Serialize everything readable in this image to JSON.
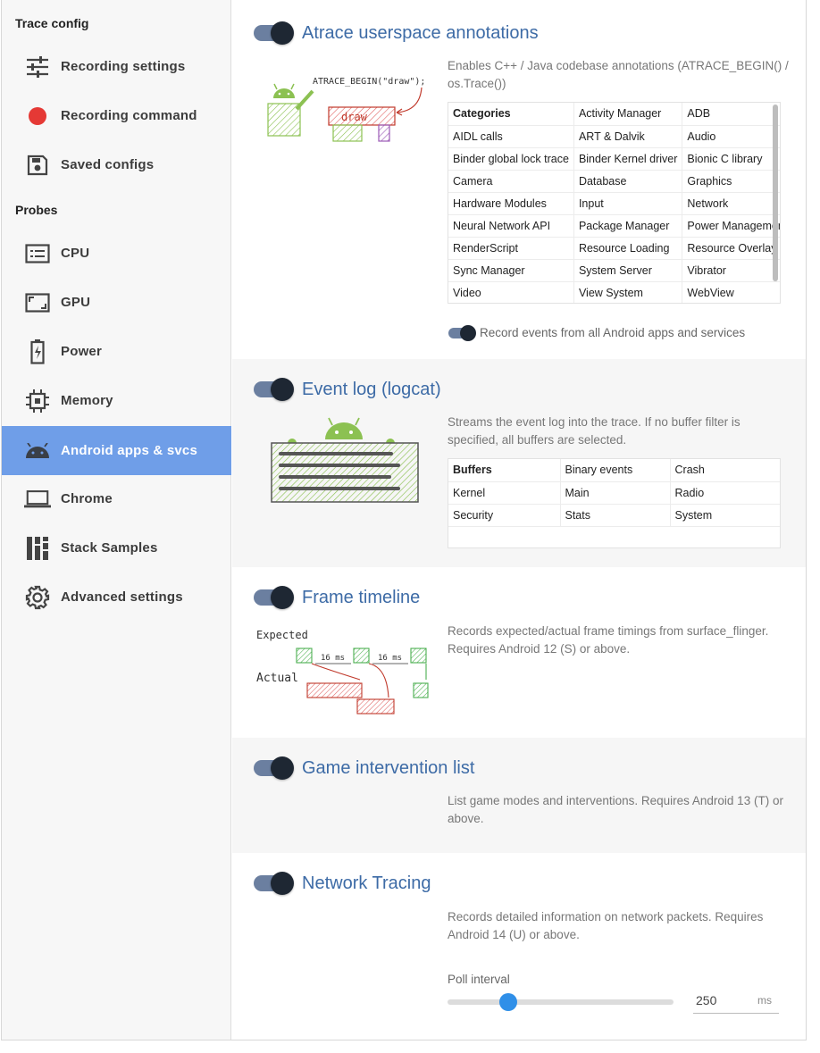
{
  "sidebar": {
    "section_trace_config": "Trace config",
    "section_probes": "Probes",
    "items": [
      {
        "label": "Recording settings",
        "icon": "tune-icon"
      },
      {
        "label": "Recording command",
        "icon": "record-dot-icon"
      },
      {
        "label": "Saved configs",
        "icon": "save-icon"
      },
      {
        "label": "CPU",
        "icon": "cpu-icon"
      },
      {
        "label": "GPU",
        "icon": "gpu-icon"
      },
      {
        "label": "Power",
        "icon": "battery-icon"
      },
      {
        "label": "Memory",
        "icon": "memory-chip-icon"
      },
      {
        "label": "Android apps & svcs",
        "icon": "android-icon"
      },
      {
        "label": "Chrome",
        "icon": "laptop-icon"
      },
      {
        "label": "Stack Samples",
        "icon": "stack-samples-icon"
      },
      {
        "label": "Advanced settings",
        "icon": "gear-icon"
      }
    ],
    "active_index": 7,
    "active_color": "#6f9ee8"
  },
  "atrace": {
    "title": "Atrace userspace annotations",
    "enabled": true,
    "description": "Enables C++ / Java codebase annotations (ATRACE_BEGIN() / os.Trace())",
    "illustration_code": "ATRACE_BEGIN(\"draw\");",
    "illustration_word": "draw",
    "grid": [
      [
        "Categories",
        "Activity Manager",
        "ADB"
      ],
      [
        "AIDL calls",
        "ART & Dalvik",
        "Audio"
      ],
      [
        "Binder global lock trace",
        "Binder Kernel driver",
        "Bionic C library"
      ],
      [
        "Camera",
        "Database",
        "Graphics"
      ],
      [
        "Hardware Modules",
        "Input",
        "Network"
      ],
      [
        "Neural Network API",
        "Package Manager",
        "Power Management"
      ],
      [
        "RenderScript",
        "Resource Loading",
        "Resource Overlay"
      ],
      [
        "Sync Manager",
        "System Server",
        "Vibrator"
      ],
      [
        "Video",
        "View System",
        "WebView"
      ]
    ],
    "all_apps_label": "Record events from all Android apps and services",
    "all_apps_enabled": true
  },
  "logcat": {
    "title": "Event log (logcat)",
    "enabled": true,
    "description": "Streams the event log into the trace. If no buffer filter is specified, all buffers are selected.",
    "grid": [
      [
        "Buffers",
        "Binary events",
        "Crash"
      ],
      [
        "Kernel",
        "Main",
        "Radio"
      ],
      [
        "Security",
        "Stats",
        "System"
      ]
    ]
  },
  "frame_timeline": {
    "title": "Frame timeline",
    "enabled": true,
    "description": "Records expected/actual frame timings from surface_flinger. Requires Android 12 (S) or above.",
    "illus_expected": "Expected",
    "illus_actual": "Actual",
    "illus_ms": "16 ms"
  },
  "game_intervention": {
    "title": "Game intervention list",
    "enabled": true,
    "description": "List game modes and interventions. Requires Android 13 (T) or above."
  },
  "network_tracing": {
    "title": "Network Tracing",
    "enabled": true,
    "description": "Records detailed information on network packets. Requires Android 14 (U) or above.",
    "poll_label": "Poll interval",
    "poll_value": "250",
    "poll_unit": "ms",
    "poll_slider_fraction": 0.27
  },
  "colors": {
    "title_blue": "#3d6ba6",
    "toggle_track": "#6b7fa0",
    "toggle_knob": "#1e2733",
    "slider_thumb": "#2f8fe8",
    "record_red": "#e53935"
  }
}
